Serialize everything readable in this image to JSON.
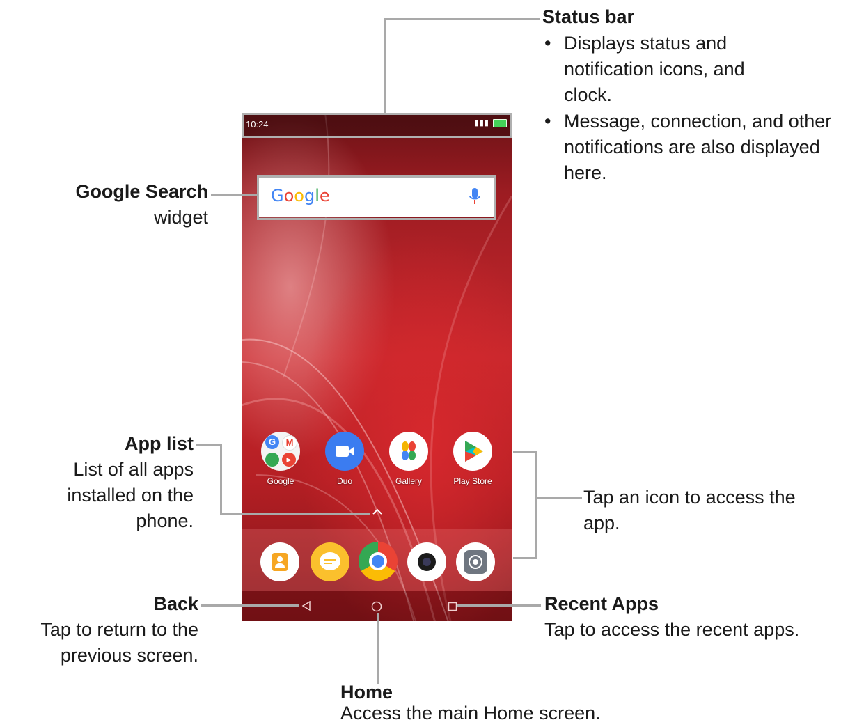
{
  "phone": {
    "clock": "10:24",
    "search": {
      "logo_text": "Google",
      "icon": "mic-icon"
    },
    "apps": [
      {
        "name": "Google",
        "icon": "google-folder-icon"
      },
      {
        "name": "Duo",
        "icon": "duo-icon"
      },
      {
        "name": "Gallery",
        "icon": "gallery-icon"
      },
      {
        "name": "Play Store",
        "icon": "play-store-icon"
      }
    ],
    "dock": [
      {
        "icon": "contacts-icon"
      },
      {
        "icon": "messages-icon"
      },
      {
        "icon": "chrome-icon"
      },
      {
        "icon": "camera-icon"
      },
      {
        "icon": "settings-icon"
      }
    ],
    "nav": {
      "back_icon": "back-triangle-icon",
      "home_icon": "home-circle-icon",
      "recent_icon": "recent-square-icon"
    }
  },
  "callouts": {
    "status_bar": {
      "title": "Status bar",
      "bullet_symbol": "•",
      "bullets": [
        "Displays status and notification icons, and clock.",
        "Message, connection, and other notifications are also displayed here."
      ]
    },
    "google_search": {
      "title": "Google Search",
      "desc": "widget"
    },
    "app_list": {
      "title": "App list",
      "desc": "List of all apps installed on the phone."
    },
    "tap_icon": {
      "desc": "Tap an icon to access the app."
    },
    "back": {
      "title": "Back",
      "desc": "Tap to return to the previous screen."
    },
    "recent_apps": {
      "title": "Recent Apps",
      "desc": "Tap to access the recent apps."
    },
    "home": {
      "title": "Home",
      "desc": "Access the main Home screen."
    }
  },
  "colors": {
    "leader_line": "#a9a9a9",
    "wallpaper_red": "#c8282d",
    "google_blue": "#4285f4",
    "google_red": "#ea4335",
    "google_yellow": "#fbbc05",
    "google_green": "#34a853"
  }
}
